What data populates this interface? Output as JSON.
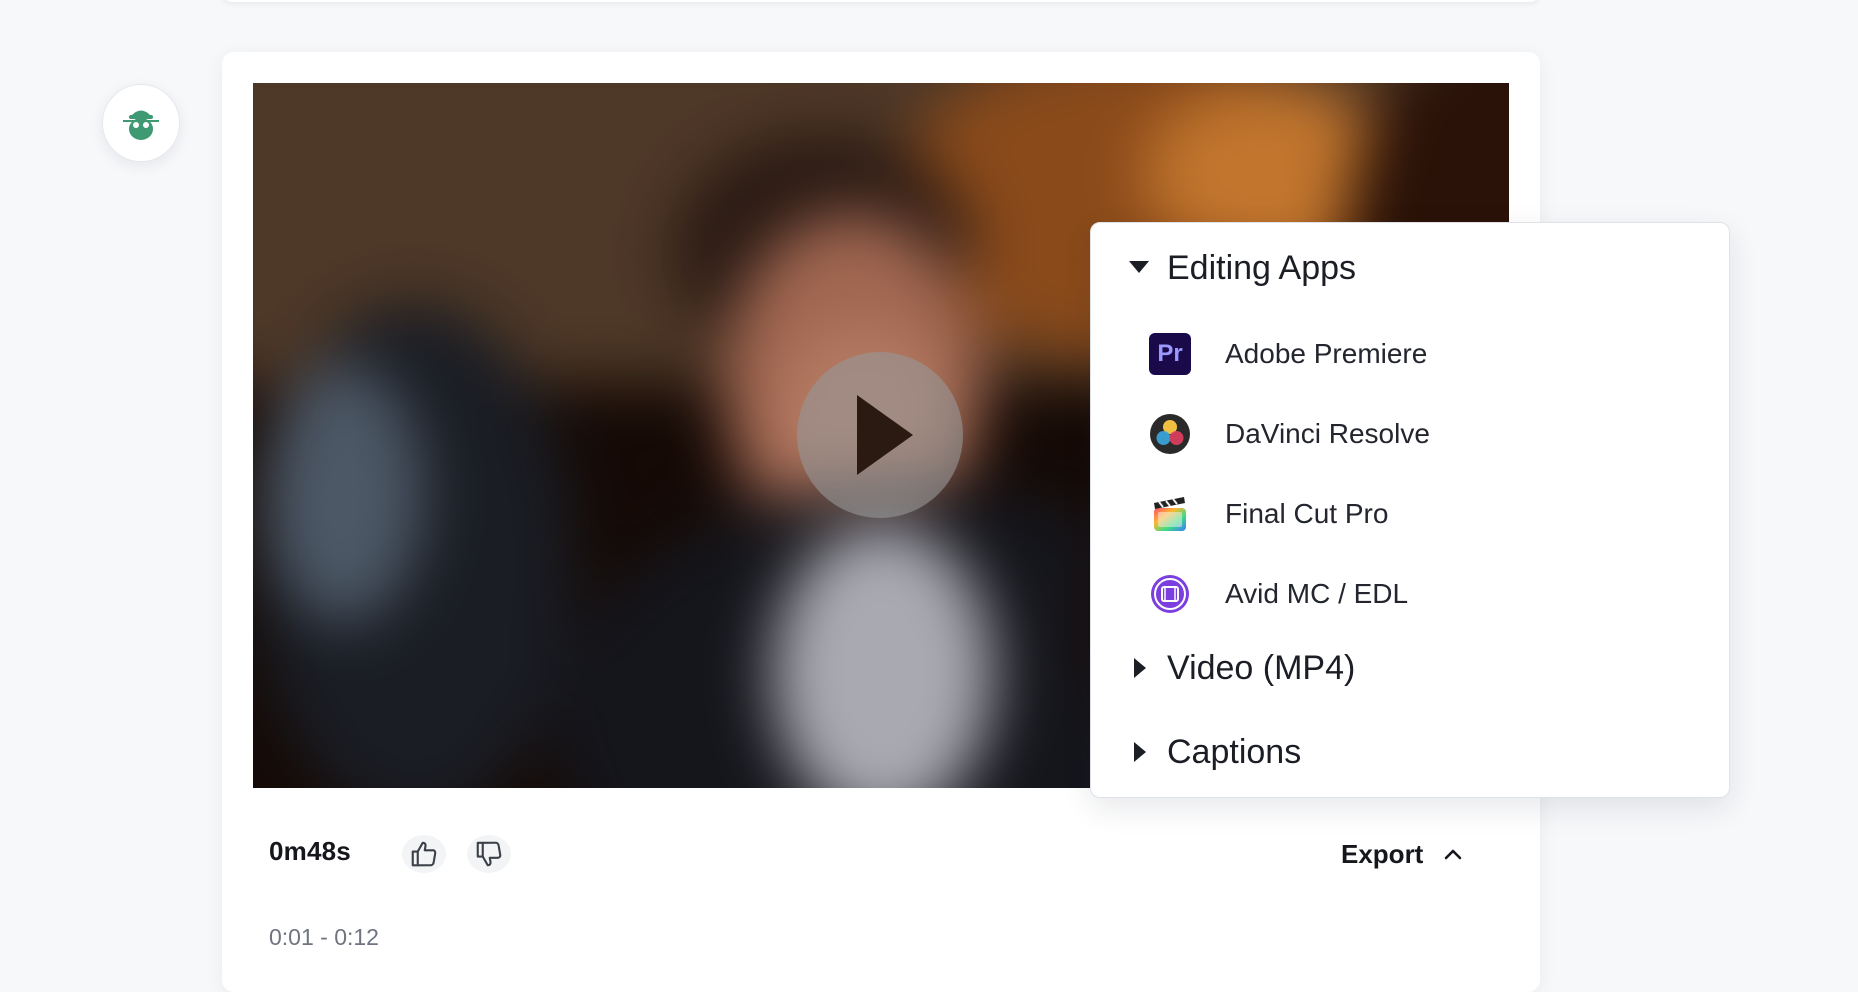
{
  "menu": {
    "sections": [
      {
        "label": "Editing Apps",
        "expanded": true
      },
      {
        "label": "Video (MP4)",
        "expanded": false
      },
      {
        "label": "Captions",
        "expanded": false
      }
    ],
    "items": [
      {
        "label": "Adobe Premiere",
        "icon": "adobe-premiere-icon",
        "icon_text": "Pr",
        "color": "#1a0a4a"
      },
      {
        "label": "DaVinci Resolve",
        "icon": "davinci-resolve-icon"
      },
      {
        "label": "Final Cut Pro",
        "icon": "final-cut-pro-icon"
      },
      {
        "label": "Avid MC / EDL",
        "icon": "avid-icon",
        "color": "#7b3fe0"
      }
    ]
  },
  "clip": {
    "duration": "0m48s",
    "export_label": "Export",
    "time_range": "0:01 - 0:12"
  },
  "colors": {
    "avatar_accent": "#3f9a73",
    "premiere_text": "#9999ff"
  }
}
